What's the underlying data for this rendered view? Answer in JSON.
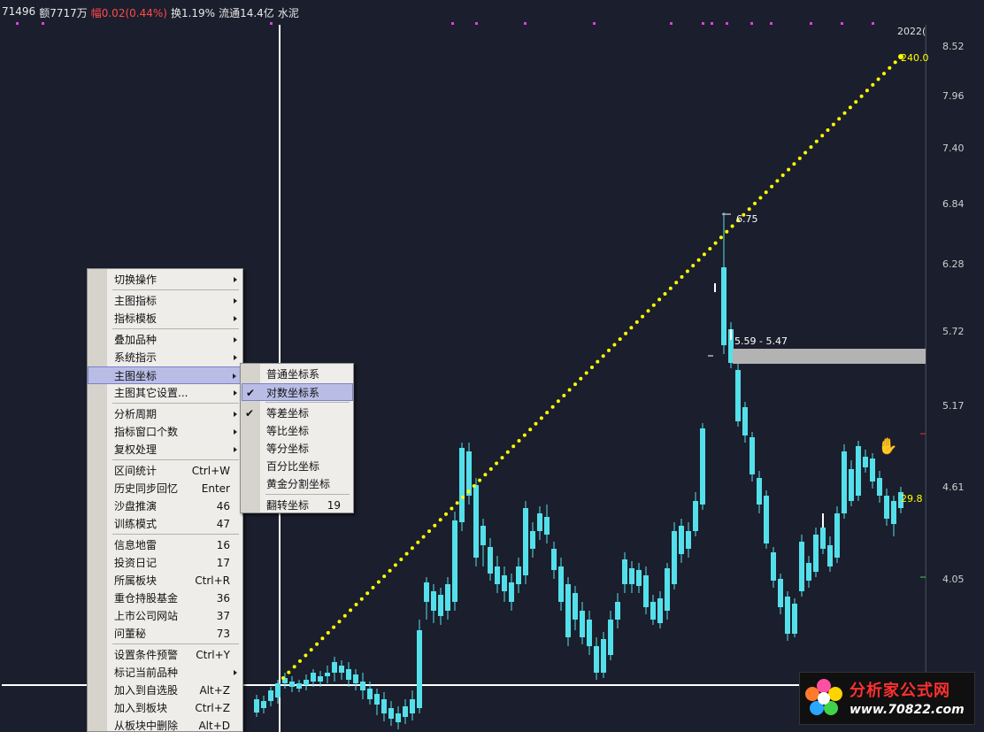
{
  "header": {
    "vol": "71496",
    "amount": "额7717万",
    "change": "幅0.02(0.44%)",
    "turnover": "换1.19%",
    "float_cap": "流通14.4亿",
    "sector": "水泥"
  },
  "axis": {
    "date_label": "2022(",
    "ticks": [
      "8.52",
      "7.96",
      "7.40",
      "6.84",
      "6.28",
      "5.72",
      "5.17",
      "4.61",
      "4.05"
    ]
  },
  "annotations": {
    "line_end": "240.0",
    "line_now": "29.8",
    "high_price": "6.75",
    "gap_range": "5.59 - 5.47"
  },
  "context_menu": [
    {
      "label": "切换操作",
      "submenu": true
    },
    {
      "sep": true
    },
    {
      "label": "主图指标",
      "submenu": true
    },
    {
      "label": "指标模板",
      "submenu": true
    },
    {
      "sep": true
    },
    {
      "label": "叠加品种",
      "submenu": true
    },
    {
      "label": "系统指示",
      "submenu": true
    },
    {
      "label": "主图坐标",
      "submenu": true,
      "highlighted": true
    },
    {
      "label": "主图其它设置...",
      "submenu": true
    },
    {
      "sep": true
    },
    {
      "label": "分析周期",
      "submenu": true
    },
    {
      "label": "指标窗口个数",
      "submenu": true
    },
    {
      "label": "复权处理",
      "submenu": true
    },
    {
      "sep": true
    },
    {
      "label": "区间统计",
      "shortcut": "Ctrl+W"
    },
    {
      "label": "历史同步回忆",
      "shortcut": "Enter"
    },
    {
      "label": "沙盘推演",
      "shortcut": "46"
    },
    {
      "label": "训练模式",
      "shortcut": "47"
    },
    {
      "sep": true
    },
    {
      "label": "信息地雷",
      "shortcut": "16"
    },
    {
      "label": "投资日记",
      "shortcut": "17"
    },
    {
      "label": "所属板块",
      "shortcut": "Ctrl+R"
    },
    {
      "label": "重仓持股基金",
      "shortcut": "36"
    },
    {
      "label": "上市公司网站",
      "shortcut": "37"
    },
    {
      "label": "问董秘",
      "shortcut": "73"
    },
    {
      "sep": true
    },
    {
      "label": "设置条件预警",
      "shortcut": "Ctrl+Y"
    },
    {
      "label": "标记当前品种",
      "submenu": true
    },
    {
      "label": "加入到自选股",
      "shortcut": "Alt+Z"
    },
    {
      "label": "加入到板块",
      "shortcut": "Ctrl+Z"
    },
    {
      "label": "从板块中删除",
      "shortcut": "Alt+D"
    }
  ],
  "sub_menu": [
    {
      "label": "普通坐标系"
    },
    {
      "label": "对数坐标系",
      "checked": true,
      "highlighted": true
    },
    {
      "sep": true
    },
    {
      "label": "等差坐标",
      "checked": true
    },
    {
      "label": "等比坐标"
    },
    {
      "label": "等分坐标"
    },
    {
      "label": "百分比坐标"
    },
    {
      "label": "黄金分割坐标"
    },
    {
      "sep": true
    },
    {
      "label": "翻转坐标",
      "shortcut": "19"
    }
  ],
  "watermark": {
    "title": "分析家公式网",
    "url": "www.70822.com"
  },
  "colors": {
    "up": "#e8323c",
    "down": "#54e0ea",
    "trendline": "#ffff00",
    "background": "#1b1e2c"
  }
}
